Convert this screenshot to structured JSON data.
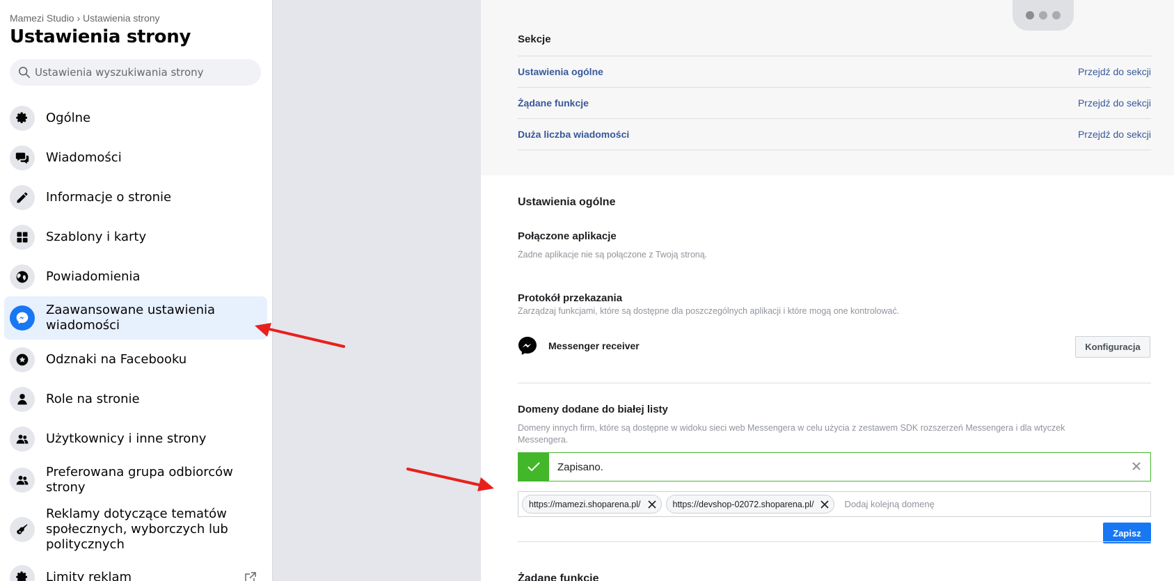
{
  "sidebar": {
    "breadcrumb": "Mamezi Studio › Ustawienia strony",
    "title": "Ustawienia strony",
    "search_placeholder": "Ustawienia wyszukiwania strony",
    "items": [
      {
        "label": "Ogólne",
        "icon": "gear-icon"
      },
      {
        "label": "Wiadomości",
        "icon": "chat-bubbles-icon"
      },
      {
        "label": "Informacje o stronie",
        "icon": "pencil-icon"
      },
      {
        "label": "Szablony i karty",
        "icon": "grid-icon"
      },
      {
        "label": "Powiadomienia",
        "icon": "globe-icon"
      },
      {
        "label": "Zaawansowane ustawienia wiadomości",
        "icon": "messenger-icon",
        "active": true
      },
      {
        "label": "Odznaki na Facebooku",
        "icon": "star-badge-icon"
      },
      {
        "label": "Role na stronie",
        "icon": "person-icon"
      },
      {
        "label": "Użytkownicy i inne strony",
        "icon": "people-icon"
      },
      {
        "label": "Preferowana grupa odbiorców strony",
        "icon": "people-icon"
      },
      {
        "label": "Reklamy dotyczące tematów społecznych, wyborczych lub politycznych",
        "icon": "guitar-icon"
      },
      {
        "label": "Limity reklam",
        "icon": "gear-icon"
      }
    ]
  },
  "sections": {
    "heading": "Sekcje",
    "rows": [
      {
        "name": "Ustawienia ogólne",
        "link": "Przejdź do sekcji"
      },
      {
        "name": "Żądane funkcje",
        "link": "Przejdź do sekcji"
      },
      {
        "name": "Duża liczba wiadomości",
        "link": "Przejdź do sekcji"
      }
    ]
  },
  "general": {
    "heading": "Ustawienia ogólne",
    "connected_apps": {
      "title": "Połączone aplikacje",
      "desc": "Żadne aplikacje nie są połączone z Twoją stroną."
    },
    "handover": {
      "title": "Protokół przekazania",
      "desc": "Zarządzaj funkcjami, które są dostępne dla poszczególnych aplikacji i które mogą one kontrolować.",
      "app_name": "Messenger receiver",
      "config_button": "Konfiguracja"
    },
    "whitelist": {
      "title": "Domeny dodane do białej listy",
      "desc": "Domeny innych firm, które są dostępne w widoku sieci web Messengera w celu użycia z zestawem SDK rozszerzeń Messengera i dla wtyczek Messengera.",
      "saved_message": "Zapisano.",
      "domains": [
        "https://mamezi.shoparena.pl/",
        "https://devshop-02072.shoparena.pl/"
      ],
      "input_placeholder": "Dodaj kolejną domenę",
      "save_button": "Zapisz"
    }
  },
  "next_heading": "Żądane funkcje",
  "colors": {
    "accent": "#1877f2",
    "link": "#385898",
    "success": "#42b72a",
    "annotation_arrow": "#e8201d"
  }
}
